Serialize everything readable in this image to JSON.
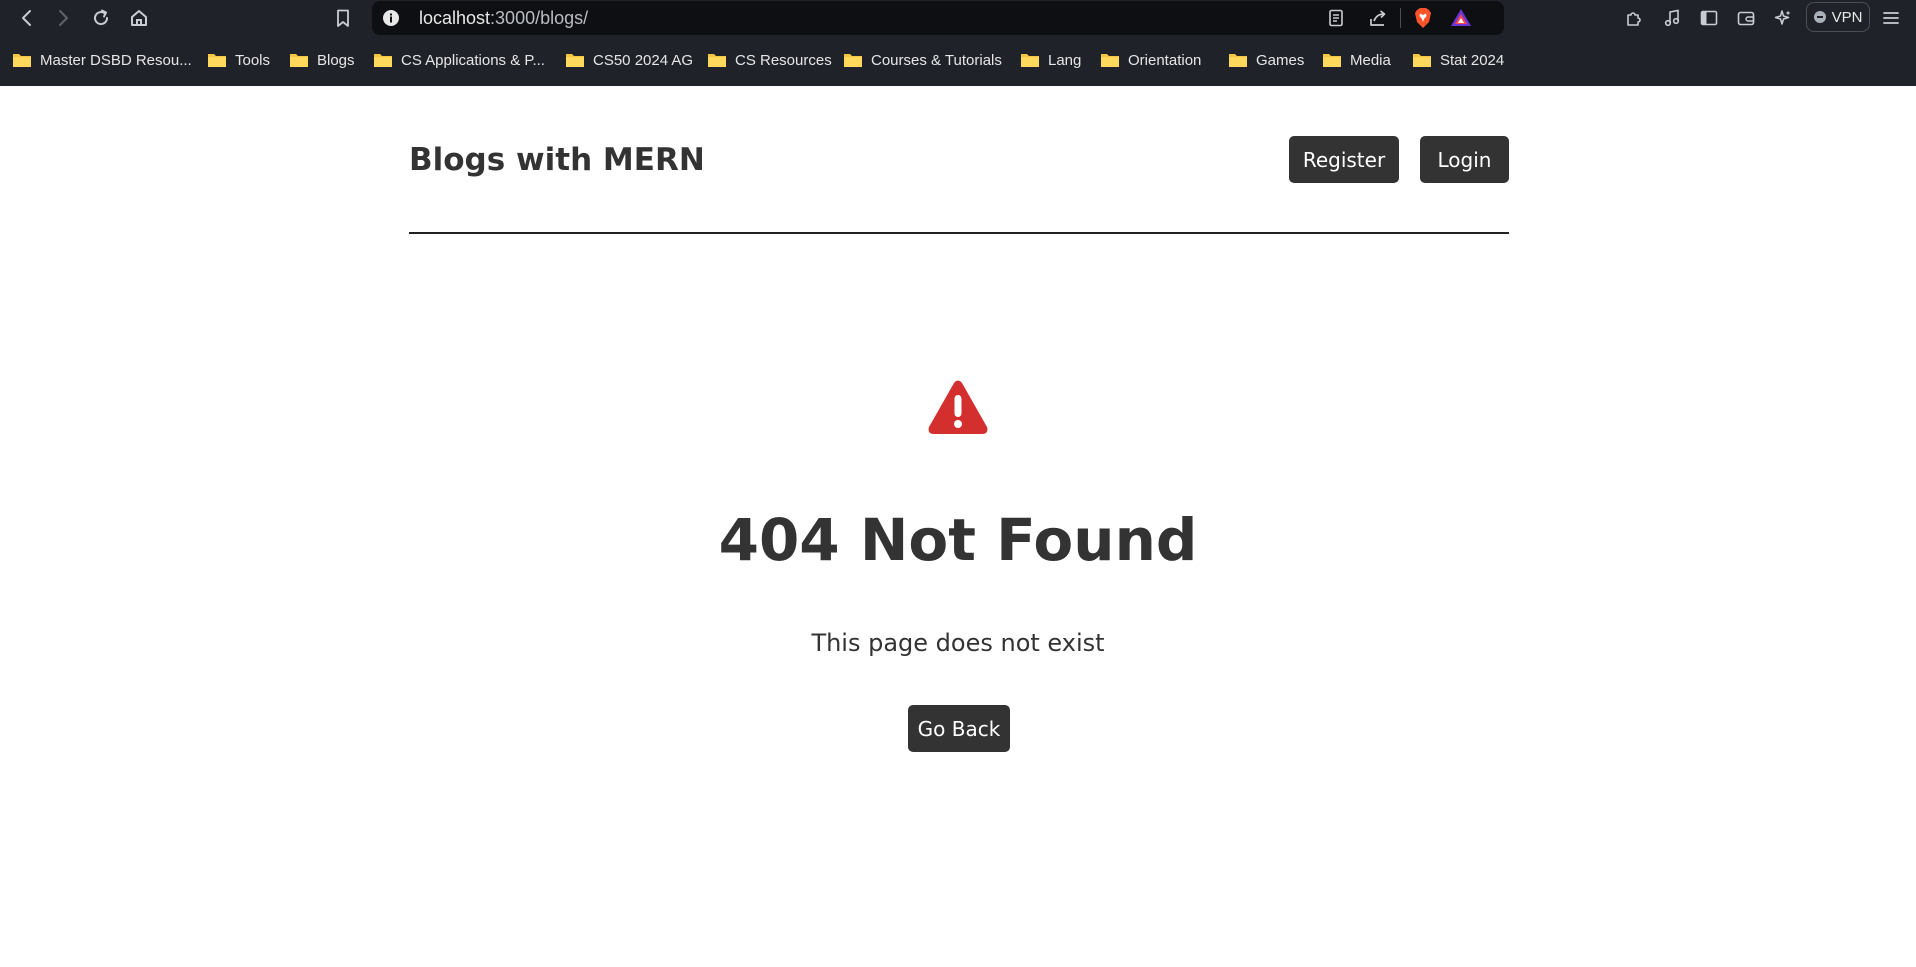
{
  "browser": {
    "url_host": "localhost",
    "url_path": ":3000/blogs/",
    "vpn_label": "VPN",
    "bookmarks": [
      {
        "label": "Master DSBD Resou...",
        "icon": "folder-icon"
      },
      {
        "label": "Tools",
        "icon": "folder-icon"
      },
      {
        "label": "Blogs",
        "icon": "folder-icon"
      },
      {
        "label": "CS Applications & P...",
        "icon": "folder-icon"
      },
      {
        "label": "CS50 2024 AG",
        "icon": "folder-icon"
      },
      {
        "label": "CS Resources",
        "icon": "folder-icon"
      },
      {
        "label": "Courses & Tutorials",
        "icon": "folder-icon"
      },
      {
        "label": "Lang",
        "icon": "folder-icon"
      },
      {
        "label": "Orientation",
        "icon": "folder-icon"
      },
      {
        "label": "Games",
        "icon": "folder-icon"
      },
      {
        "label": "Media",
        "icon": "folder-icon"
      },
      {
        "label": "Stat 2024",
        "icon": "folder-icon"
      }
    ],
    "toolbar_icons": [
      "back-icon",
      "forward-icon",
      "reload-icon",
      "home-icon",
      "bookmark-icon",
      "site-info-icon",
      "reader-mode-icon",
      "share-icon",
      "brave-shields-icon",
      "brave-rewards-icon",
      "extensions-icon",
      "media-icon",
      "sidebar-icon",
      "wallet-icon",
      "leo-ai-icon",
      "menu-icon"
    ]
  },
  "site": {
    "title": "Blogs with MERN",
    "nav": {
      "register_label": "Register",
      "login_label": "Login"
    }
  },
  "error": {
    "icon": "warning-icon",
    "title": "404 Not Found",
    "message": "This page does not exist",
    "back_label": "Go Back"
  },
  "colors": {
    "chrome_bg": "#1f2329",
    "urlbar_bg": "#0d0f12",
    "button_bg": "#333333",
    "warning": "#d32f2f",
    "folder": "#f5c542"
  }
}
